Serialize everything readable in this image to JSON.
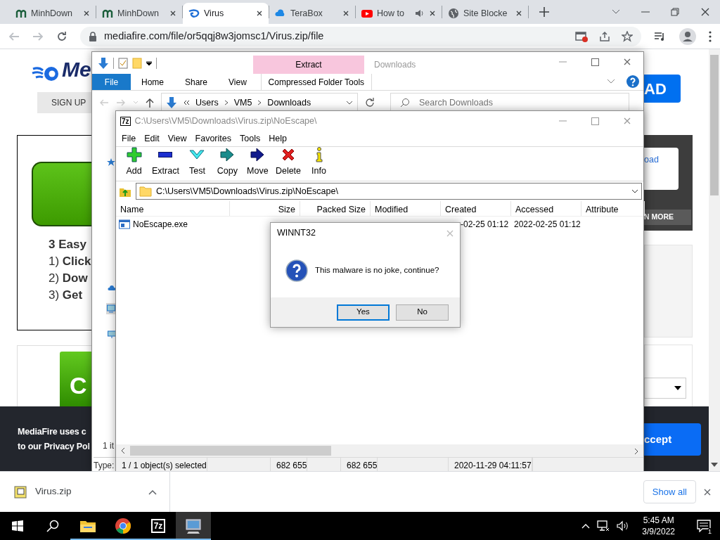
{
  "browser": {
    "tabs": [
      {
        "title": "MinhDown",
        "kind": "m",
        "selected": false,
        "audio": false
      },
      {
        "title": "MinhDown",
        "kind": "m",
        "selected": false,
        "audio": false
      },
      {
        "title": "Virus",
        "kind": "flame",
        "selected": true,
        "audio": false
      },
      {
        "title": "TeraBox",
        "kind": "cloud",
        "selected": false,
        "audio": false
      },
      {
        "title": "How to",
        "kind": "video",
        "selected": false,
        "audio": true
      },
      {
        "title": "Site Blocke",
        "kind": "globe",
        "selected": false,
        "audio": false
      }
    ],
    "address": "mediafire.com/file/or5qqj8w3jomsc1/Virus.zip/file"
  },
  "page": {
    "logo": "Me",
    "sign_up": "SIGN UP",
    "header_button": "AD",
    "steps_title": "3 Easy",
    "steps": [
      "1) **Click**",
      "2) **Dow**",
      "3) **Get**"
    ],
    "promo": "C",
    "side_link": "oad",
    "side_button": "N MORE",
    "cookie_lines": [
      "MediaFire uses c",
      "to our Privacy Pol"
    ],
    "cookie_button": "ccept"
  },
  "explorer": {
    "context_tab": "Extract",
    "title": "Downloads",
    "ribbon_tabs": [
      {
        "label": "File",
        "kind": "file"
      },
      {
        "label": "Home",
        "kind": "plain"
      },
      {
        "label": "Share",
        "kind": "plain"
      },
      {
        "label": "View",
        "kind": "plain"
      },
      {
        "label": "Compressed Folder Tools",
        "kind": "context"
      }
    ],
    "breadcrumb": [
      "Users",
      "VM5",
      "Downloads"
    ],
    "search_placeholder": "Search Downloads",
    "item_count": "1 it",
    "details": "Type:"
  },
  "sevenzip": {
    "logo": "7z",
    "title": "C:\\Users\\VM5\\Downloads\\Virus.zip\\NoEscape\\",
    "menu": [
      "File",
      "Edit",
      "View",
      "Favorites",
      "Tools",
      "Help"
    ],
    "tools": [
      {
        "label": "Add",
        "kind": "add"
      },
      {
        "label": "Extract",
        "kind": "extract"
      },
      {
        "label": "Test",
        "kind": "test"
      },
      {
        "label": "Copy",
        "kind": "copy"
      },
      {
        "label": "Move",
        "kind": "move"
      },
      {
        "label": "Delete",
        "kind": "delete"
      },
      {
        "label": "Info",
        "kind": "info"
      }
    ],
    "path": "C:\\Users\\VM5\\Downloads\\Virus.zip\\NoEscape\\",
    "columns": [
      "Name",
      "Size",
      "Packed Size",
      "Modified",
      "Created",
      "Accessed",
      "Attribute"
    ],
    "rows": [
      {
        "name": "NoEscape.exe",
        "created": "-02-25 01:12",
        "accessed": "2022-02-25 01:12"
      }
    ],
    "status": [
      "1 / 1 object(s) selected",
      "682 655",
      "682 655",
      "2020-11-29 04:11:57"
    ]
  },
  "dialog": {
    "title": "WINNT32",
    "message": "This malware is no joke, continue?",
    "buttons": [
      {
        "label": "Yes",
        "default": true
      },
      {
        "label": "No",
        "default": false
      }
    ]
  },
  "downloads": {
    "file": "Virus.zip",
    "show_all": "Show all"
  },
  "taskbar": {
    "apps": [
      {
        "kind": "explorer",
        "running": true,
        "selected": false
      },
      {
        "kind": "chrome",
        "running": true,
        "selected": false
      },
      {
        "kind": "sevenzip",
        "label": "7z",
        "running": true,
        "selected": false
      },
      {
        "kind": "setup",
        "running": true,
        "selected": true
      }
    ],
    "time": "5:45 AM",
    "date": "3/9/2022",
    "notifications": "1"
  }
}
